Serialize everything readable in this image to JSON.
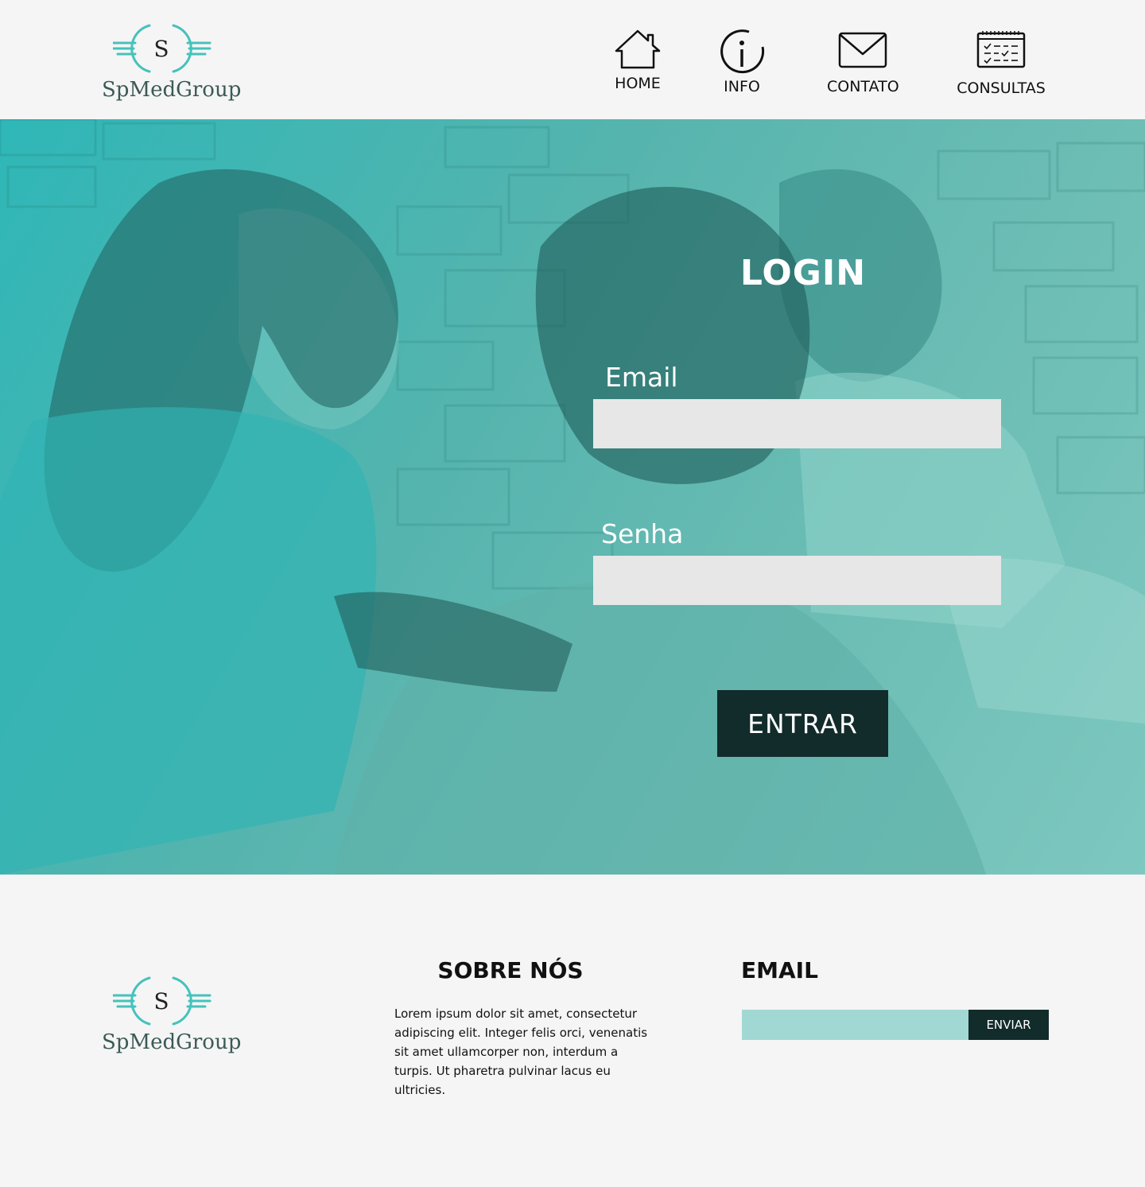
{
  "brand": {
    "name": "SpMedGroup",
    "initial": "S",
    "colors": {
      "accent": "#45c2bb",
      "text": "#3c5a55"
    }
  },
  "nav": [
    {
      "label": "HOME",
      "icon": "home-icon"
    },
    {
      "label": "INFO",
      "icon": "info-icon"
    },
    {
      "label": "CONTATO",
      "icon": "mail-icon"
    },
    {
      "label": "CONSULTAS",
      "icon": "calendar-icon"
    }
  ],
  "login": {
    "title": "LOGIN",
    "email_label": "Email",
    "email_value": "",
    "password_label": "Senha",
    "password_value": "",
    "submit_label": "ENTRAR"
  },
  "footer": {
    "about_title": "SOBRE NÓS",
    "about_text": "Lorem ipsum dolor sit amet, consectetur adipiscing elit. Integer felis orci, venenatis sit amet ullamcorper non, interdum a turpis. Ut pharetra pulvinar lacus eu ultricies.",
    "email_title": "EMAIL",
    "newsletter_value": "",
    "send_label": "ENVIAR"
  },
  "colors": {
    "header_bg": "#f5f5f5",
    "hero_overlay": "#55b4ae",
    "input_bg": "#e7e7e7",
    "button_dark": "#122b2b",
    "newsletter_input": "#a2d8d3"
  }
}
